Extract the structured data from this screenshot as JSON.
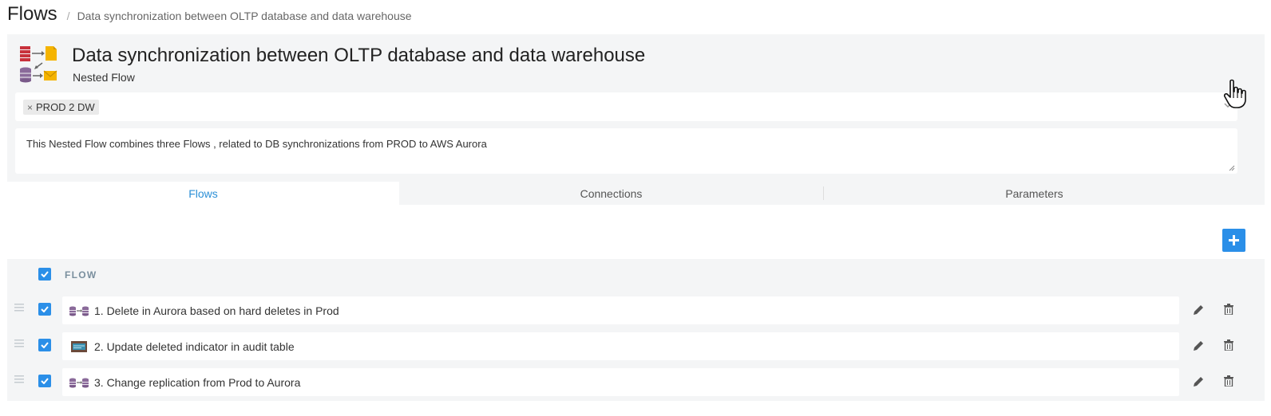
{
  "breadcrumb": {
    "root": "Flows",
    "separator": "/",
    "current": "Data synchronization between OLTP database and data warehouse"
  },
  "flow": {
    "title": "Data synchronization between OLTP database and data warehouse",
    "subtitle": "Nested Flow",
    "icon": "nested-flow-icon",
    "tags": [
      {
        "label": "PROD 2 DW",
        "remove": "×"
      }
    ],
    "description": "This Nested Flow combines three Flows , related to DB synchronizations from PROD to AWS Aurora"
  },
  "tabs": [
    {
      "label": "Flows",
      "active": true
    },
    {
      "label": "Connections",
      "active": false
    },
    {
      "label": "Parameters",
      "active": false
    }
  ],
  "table": {
    "header": "FLOW",
    "rows": [
      {
        "label": "1. Delete in Aurora based on hard deletes in Prod",
        "checked": true,
        "icon": "db-to-db-icon"
      },
      {
        "label": "2. Update deleted indicator in audit table",
        "checked": true,
        "icon": "sql-script-icon"
      },
      {
        "label": "3. Change replication from Prod to Aurora",
        "checked": true,
        "icon": "db-to-db-icon"
      }
    ]
  },
  "colors": {
    "accent": "#2b8fe8",
    "active_tab_text": "#2b8fd6",
    "panel_bg": "#f4f5f6",
    "header_text": "#7a8f9e"
  }
}
